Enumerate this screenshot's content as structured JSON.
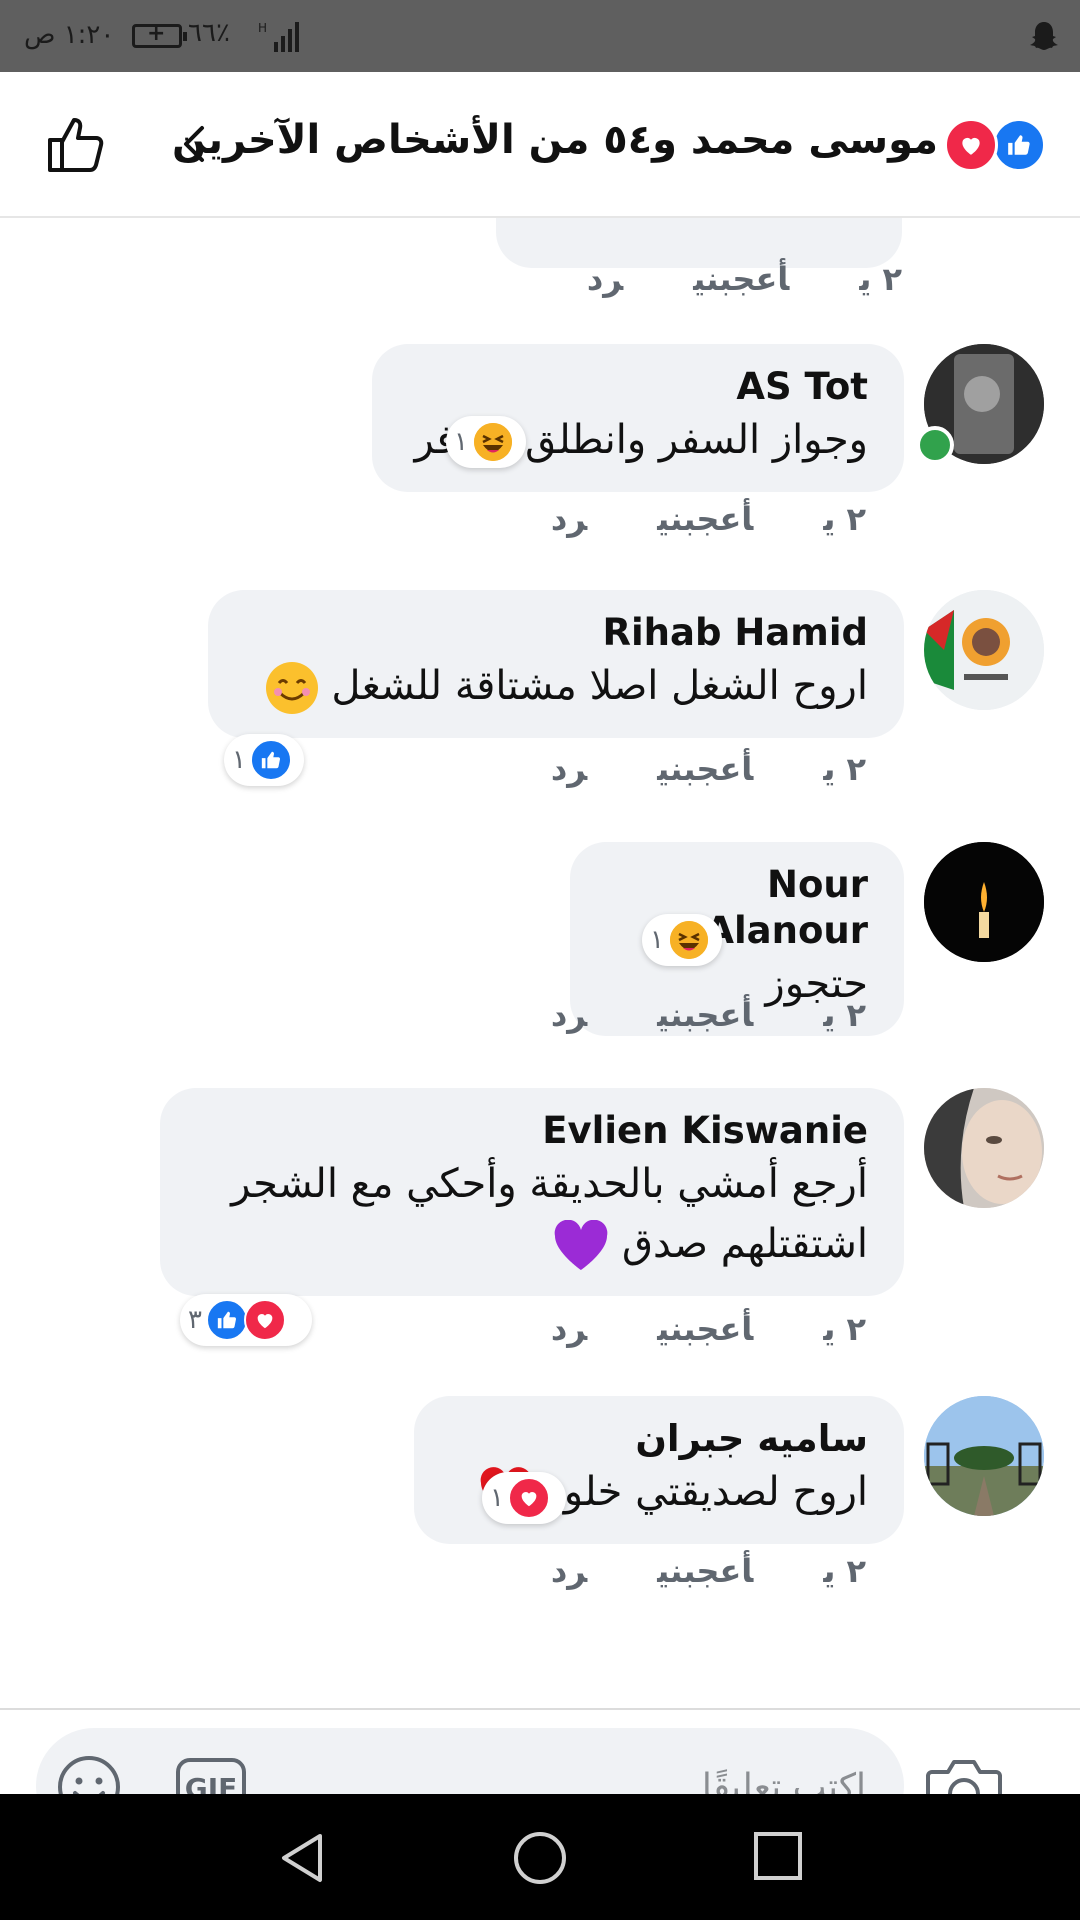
{
  "status_bar": {
    "time": "١:٢٠ ص",
    "battery": "٦٦٪"
  },
  "header": {
    "title": "موسى محمد و٥٤ من الأشخاص الآخرين"
  },
  "previous_meta": {
    "time": "٢ ي",
    "like": "أعجبني",
    "reply": "رد"
  },
  "comments": [
    {
      "author": "AS Tot",
      "lines": [
        "وجواز السفر وانطلق اسافر"
      ],
      "time": "٢ ي",
      "like": "أعجبني",
      "reply": "رد",
      "reaction_count": "١",
      "reactions": [
        "haha"
      ],
      "online": true
    },
    {
      "author": "Rihab Hamid",
      "lines": [
        "اروح الشغل اصلا مشتاقة للشغل"
      ],
      "time": "٢ ي",
      "like": "أعجبني",
      "reply": "رد",
      "reaction_count": "١",
      "reactions": [
        "like"
      ]
    },
    {
      "author": "Nour Alanour",
      "lines": [
        "حتجوز"
      ],
      "time": "٢ ي",
      "like": "أعجبني",
      "reply": "رد",
      "reaction_count": "١",
      "reactions": [
        "haha"
      ]
    },
    {
      "author": "Evlien Kiswanie",
      "lines": [
        "أرجع أمشي بالحديقة وأحكي مع الشجر",
        "اشتقتلهم صدق"
      ],
      "time": "٢ ي",
      "like": "أعجبني",
      "reply": "رد",
      "reaction_count": "٣",
      "reactions": [
        "like",
        "love"
      ]
    },
    {
      "author": "ساميه جبران",
      "lines": [
        "اروح لصديقتي خلود"
      ],
      "time": "٢ ي",
      "like": "أعجبني",
      "reply": "رد",
      "reaction_count": "١",
      "reactions": [
        "love"
      ]
    }
  ],
  "composer": {
    "placeholder": "اكتب تعليقًا...",
    "gif_label": "GIF"
  },
  "colors": {
    "like_blue": "#1877f2",
    "love_red": "#f02849",
    "haha_yellow": "#f7b125",
    "bubble_gray": "#f0f2f5"
  },
  "icons": {
    "header_left": "thumbs-up-outline-icon",
    "back": "chevron-left-icon",
    "camera": "camera-icon",
    "emoji": "smiley-icon"
  }
}
